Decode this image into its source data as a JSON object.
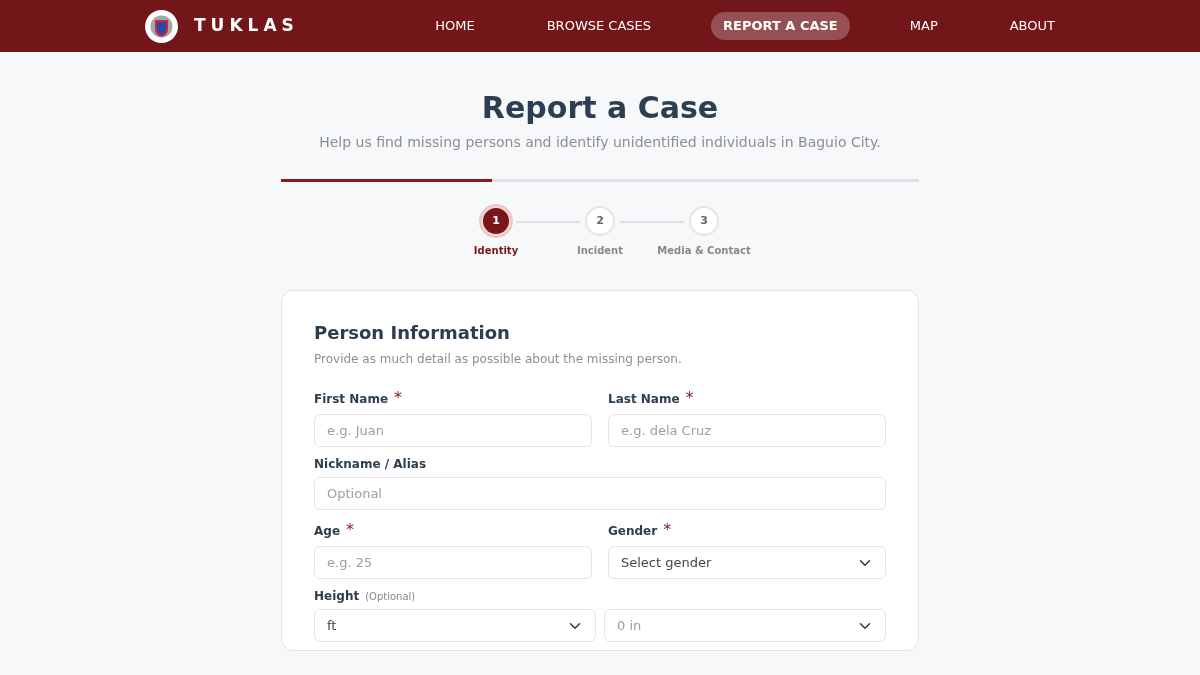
{
  "brand": {
    "name": "TUKLAS"
  },
  "nav": [
    {
      "label": "HOME",
      "selected": false
    },
    {
      "label": "BROWSE CASES",
      "selected": false
    },
    {
      "label": "REPORT A CASE",
      "selected": true
    },
    {
      "label": "MAP",
      "selected": false
    },
    {
      "label": "ABOUT",
      "selected": false
    }
  ],
  "header": {
    "title": "Report a Case",
    "subtitle": "Help us find missing persons and identify unidentified individuals in Baguio City."
  },
  "progress": {
    "level": 0.33
  },
  "steps": [
    {
      "number": "1",
      "label": "Identity",
      "selected": true
    },
    {
      "number": "2",
      "label": "Incident",
      "selected": false
    },
    {
      "number": "3",
      "label": "Media & Contact",
      "selected": false
    }
  ],
  "card": {
    "title": "Person Information",
    "required_mark": "*",
    "description": "Provide as much detail as possible about the missing person.",
    "rows": [
      [
        {
          "label": "First Name",
          "required": true,
          "controls": [
            {
              "kind": "input",
              "placeholder": "e.g. Juan"
            }
          ]
        },
        {
          "label": "Last Name",
          "required": true,
          "controls": [
            {
              "kind": "input",
              "placeholder": "e.g. dela Cruz"
            }
          ]
        }
      ],
      [
        {
          "label": "Nickname / Alias",
          "required": false,
          "controls": [
            {
              "kind": "input",
              "placeholder": "Optional"
            }
          ]
        }
      ],
      [
        {
          "label": "Age",
          "required": true,
          "controls": [
            {
              "kind": "input",
              "placeholder": "e.g. 25"
            }
          ]
        },
        {
          "label": "Gender",
          "required": true,
          "controls": [
            {
              "kind": "select",
              "value": "Select gender"
            }
          ]
        }
      ],
      [
        {
          "label": "Height",
          "required": false,
          "note": "(Optional)",
          "controls": [
            {
              "kind": "select",
              "value": "ft"
            },
            {
              "kind": "select",
              "placeholder": "0 in"
            }
          ]
        }
      ]
    ]
  }
}
